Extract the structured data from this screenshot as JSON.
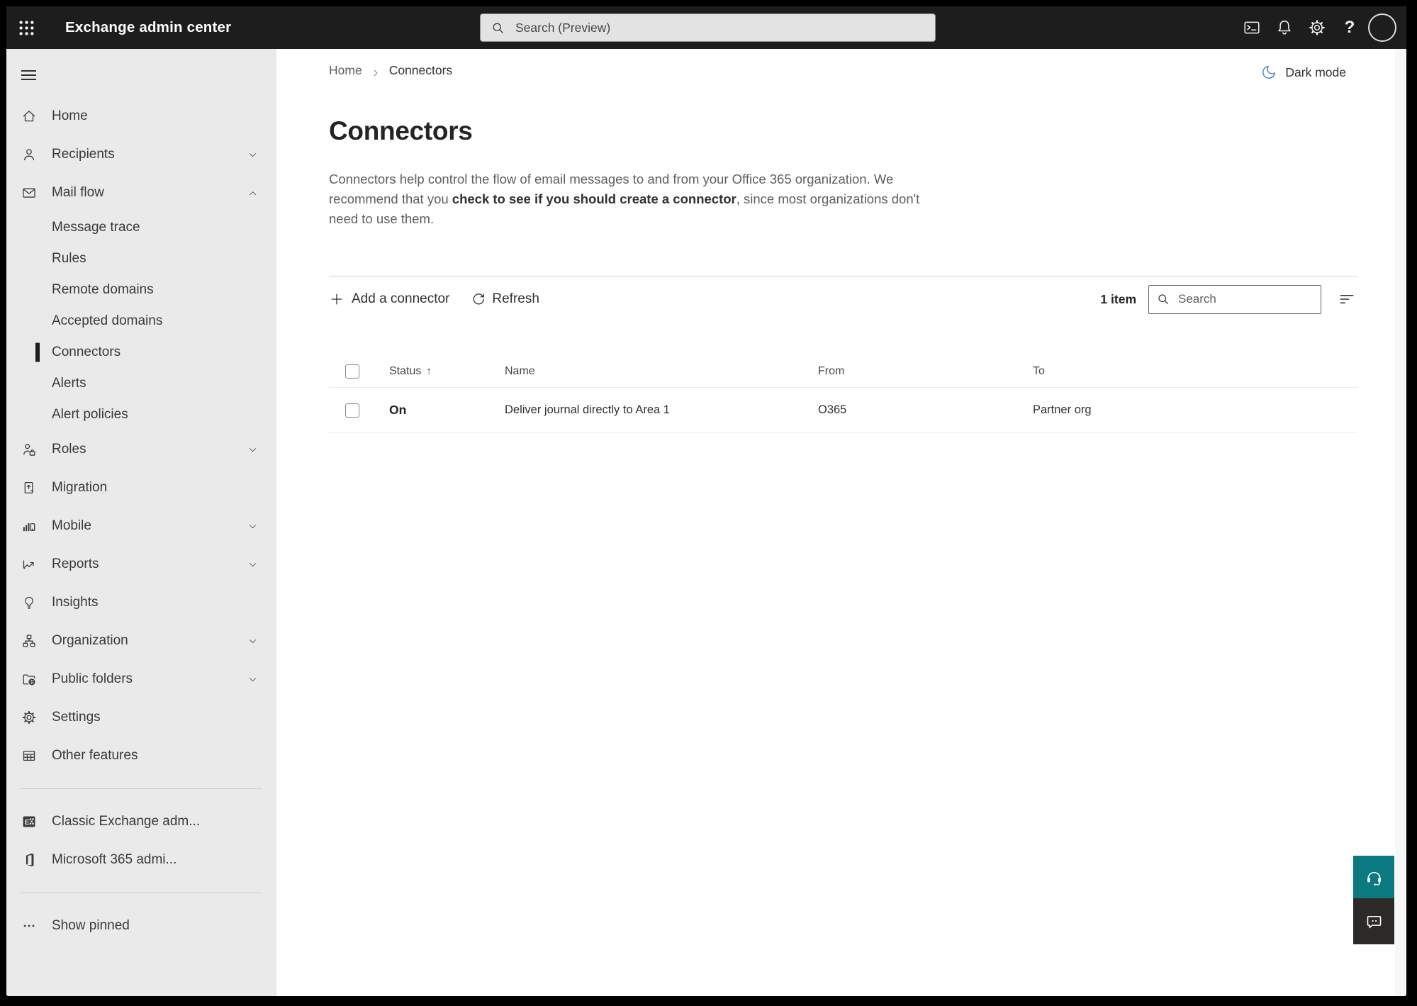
{
  "topbar": {
    "app_launcher_icon": "waffle-icon",
    "app_title": "Exchange admin center",
    "search": {
      "icon": "search-icon",
      "placeholder": "Search (Preview)"
    },
    "actions": [
      {
        "name": "cloud-shell",
        "icon": "terminal-icon"
      },
      {
        "name": "notifications",
        "icon": "bell-icon"
      },
      {
        "name": "settings",
        "icon": "gear-icon"
      },
      {
        "name": "help",
        "icon": "help-icon"
      }
    ],
    "avatar": {
      "icon": "avatar-circle"
    }
  },
  "sidebar": {
    "menu_icon": "hamburger-icon",
    "items": [
      {
        "label": "Home",
        "icon": "home-icon"
      },
      {
        "label": "Recipients",
        "icon": "person-icon",
        "chevron": "down"
      },
      {
        "label": "Mail flow",
        "icon": "mail-icon",
        "chevron": "up"
      },
      {
        "label": "Message trace",
        "sub": true
      },
      {
        "label": "Rules",
        "sub": true
      },
      {
        "label": "Remote domains",
        "sub": true
      },
      {
        "label": "Accepted domains",
        "sub": true
      },
      {
        "label": "Connectors",
        "sub": true,
        "selected": true
      },
      {
        "label": "Alerts",
        "sub": true
      },
      {
        "label": "Alert policies",
        "sub": true
      },
      {
        "label": "Roles",
        "icon": "roles-icon",
        "chevron": "down"
      },
      {
        "label": "Migration",
        "icon": "migration-icon"
      },
      {
        "label": "Mobile",
        "icon": "mobile-icon",
        "chevron": "down"
      },
      {
        "label": "Reports",
        "icon": "reports-icon",
        "chevron": "down"
      },
      {
        "label": "Insights",
        "icon": "insights-icon"
      },
      {
        "label": "Organization",
        "icon": "organization-icon",
        "chevron": "down"
      },
      {
        "label": "Public folders",
        "icon": "public-folders-icon",
        "chevron": "down"
      },
      {
        "label": "Settings",
        "icon": "gear-icon"
      },
      {
        "label": "Other features",
        "icon": "other-features-icon"
      },
      {
        "divider": true
      },
      {
        "label": "Classic Exchange adm...",
        "icon": "classic-exchange-icon"
      },
      {
        "label": "Microsoft 365 admi...",
        "icon": "microsoft-365-icon"
      },
      {
        "divider": true
      },
      {
        "label": "Show pinned",
        "icon": "ellipsis-icon"
      }
    ]
  },
  "main": {
    "breadcrumb": [
      {
        "label": "Home",
        "current": false
      },
      {
        "label": "Connectors",
        "current": true
      }
    ],
    "dark_mode": {
      "icon": "moon-icon",
      "label": "Dark mode"
    },
    "title": "Connectors",
    "description": {
      "prefix": "Connectors help control the flow of email messages to and from your Office 365 organization. We recommend that you ",
      "emphasis": "check to see if you should create a connector",
      "suffix": ", since most organizations don't need to use them."
    },
    "toolbar": {
      "add_icon": "plus-icon",
      "add_label": "Add a connector",
      "refresh_icon": "refresh-icon",
      "refresh_label": "Refresh",
      "item_count": "1 item",
      "search": {
        "icon": "search-icon",
        "placeholder": "Search"
      },
      "filter_icon": "filter-icon"
    },
    "table": {
      "columns": [
        "Status",
        "Name",
        "From",
        "To"
      ],
      "sorted_column": "Status",
      "sort_direction": "ascending",
      "sort_icon": "sort-up-arrow",
      "rows": [
        {
          "status": "On",
          "name": "Deliver journal directly to Area 1",
          "from": "O365",
          "to": "Partner org"
        }
      ]
    }
  },
  "floating_actions": [
    {
      "name": "support",
      "icon": "headset-icon",
      "color": "#0b7a80"
    },
    {
      "name": "feedback",
      "icon": "chat-icon",
      "color": "#2b2a28"
    }
  ],
  "colors": {
    "topbar_bg": "#1e1d1d",
    "sidebar_bg": "#eaeaea",
    "accent_teal": "#0b7a80",
    "feedback_dark": "#2b2a28",
    "dark_mode_blue": "#3373d9",
    "selected_indicator": "#1f1e1e"
  }
}
